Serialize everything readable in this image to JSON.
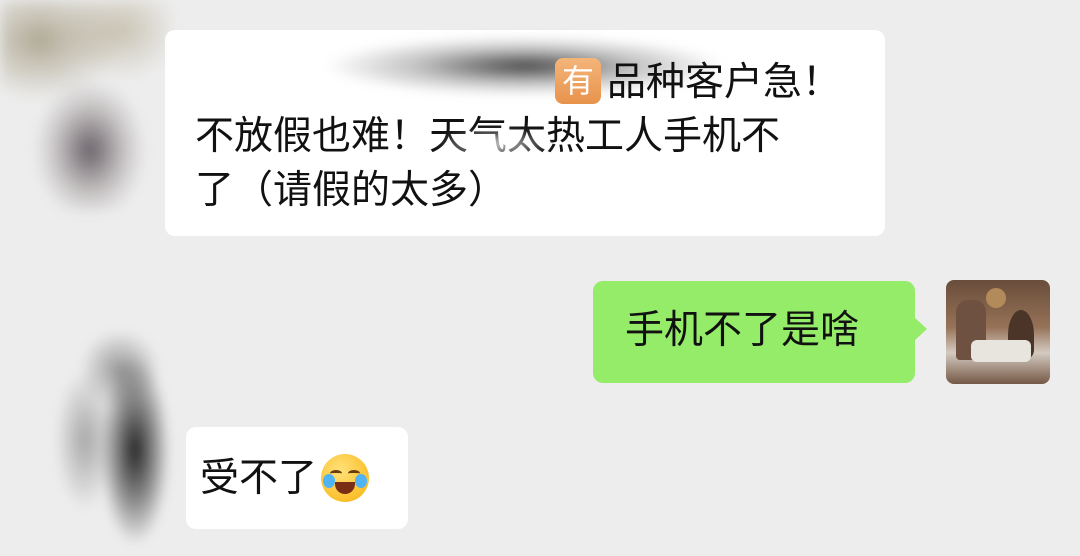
{
  "messages": [
    {
      "direction": "incoming",
      "tag_icon": "有",
      "line1": "品种客户急！",
      "line2": "不放假也难！天气太热工人手机不",
      "line3": "了（请假的太多）"
    },
    {
      "direction": "outgoing",
      "text": "手机不了是啥"
    },
    {
      "direction": "incoming",
      "text": "受不了",
      "emoji": "crying-laughing-emoji"
    }
  ],
  "colors": {
    "background": "#ededed",
    "incoming_bubble": "#ffffff",
    "outgoing_bubble": "#95ec69",
    "tag_icon": "#f0a060"
  }
}
